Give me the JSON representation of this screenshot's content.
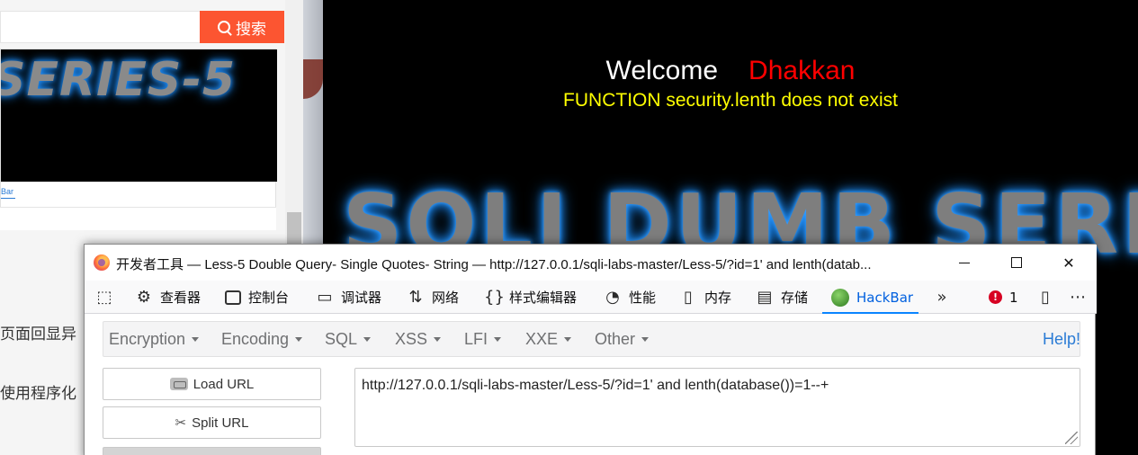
{
  "left_page": {
    "search_button": "搜索",
    "banner_text": "SERIES-5",
    "hackbar_tab": "Bar",
    "text_line_1": "页面回显异",
    "text_line_2": "使用程序化"
  },
  "target_page": {
    "welcome": "Welcome",
    "name": "Dhakkan",
    "error_message": "FUNCTION security.lenth does not exist",
    "banner_title": "SQLI DUMB SERIES"
  },
  "devtools": {
    "window_title": "开发者工具 — Less-5 Double Query- Single Quotes- String — http://127.0.0.1/sqli-labs-master/Less-5/?id=1' and lenth(datab...",
    "window_buttons": {
      "close": "✕"
    },
    "tabs": [
      {
        "label": "查看器",
        "icon": "inspector-icon"
      },
      {
        "label": "控制台",
        "icon": "console-icon"
      },
      {
        "label": "调试器",
        "icon": "debugger-icon"
      },
      {
        "label": "网络",
        "icon": "network-icon"
      },
      {
        "label": "样式编辑器",
        "icon": "style-editor-icon"
      },
      {
        "label": "性能",
        "icon": "performance-icon"
      },
      {
        "label": "内存",
        "icon": "memory-icon"
      },
      {
        "label": "存储",
        "icon": "storage-icon"
      },
      {
        "label": "HackBar",
        "icon": "hackbar-icon",
        "active": true
      }
    ],
    "error_count": "1",
    "accent_color": "#0060df"
  },
  "hackbar": {
    "menu": [
      {
        "label": "Encryption"
      },
      {
        "label": "Encoding"
      },
      {
        "label": "SQL"
      },
      {
        "label": "XSS"
      },
      {
        "label": "LFI"
      },
      {
        "label": "XXE"
      },
      {
        "label": "Other"
      }
    ],
    "help": "Help!",
    "load_url": "Load URL",
    "split_url": "Split URL",
    "url_value": "http://127.0.0.1/sqli-labs-master/Less-5/?id=1' and lenth(database())=1--+"
  }
}
